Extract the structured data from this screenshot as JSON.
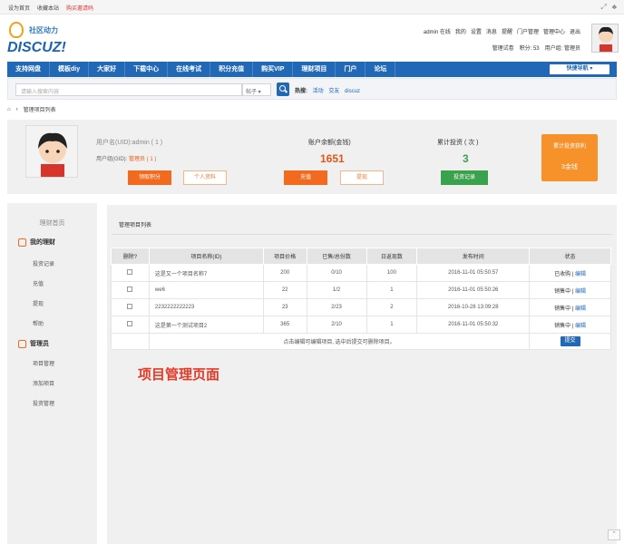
{
  "topbar": {
    "links": [
      "设为首页",
      "收藏本站"
    ],
    "notice": "购买邀请码",
    "icons": [
      "expand-icon",
      "paint-icon"
    ]
  },
  "brand": {
    "cn": "社区动力",
    "en": "DISCUZ!"
  },
  "header": {
    "row1": [
      "admin 在线",
      "我的",
      "设置",
      "消息",
      "提醒",
      "门户管理",
      "管理中心",
      "退出"
    ],
    "row2": [
      "管理试卷",
      "积分: 53",
      "用户组: 管理员"
    ]
  },
  "nav": {
    "items": [
      "支持网盘",
      "模板diy",
      "大家好",
      "下载中心",
      "在线考试",
      "积分充值",
      "购买VIP",
      "理财项目",
      "门户",
      "论坛"
    ],
    "quick": "快捷导航"
  },
  "search": {
    "placeholder": "请输入搜索内容",
    "scope": "帖子",
    "hot_label": "热搜:",
    "hot": [
      "活动",
      "交友",
      "discuz"
    ]
  },
  "breadcrumb": {
    "current": "管理项目列表"
  },
  "profile": {
    "name_line": "用户名(UID):admin ( 1 )",
    "group_label": "用户组(GID):",
    "group_value": "管理员 ( 1 )",
    "btn_points": "领取积分",
    "btn_info": "个人资料",
    "balance_label": "账户余额(金钱)",
    "balance_value": "1651",
    "btn_recharge": "充值",
    "btn_withdraw": "提现",
    "invest_label": "累计投资 ( 次 )",
    "invest_value": "3",
    "btn_records": "投资记录",
    "earn_label": "累计投资获利",
    "earn_value": "3金钱"
  },
  "sidebar": {
    "title": "理财首页",
    "group1": "我的理财",
    "group1_items": [
      "投资记录",
      "充值",
      "提现",
      "帮助"
    ],
    "group2": "管理员",
    "group2_items": [
      "项目管理",
      "添加项目",
      "投资管理"
    ]
  },
  "panel": {
    "title": "管理项目列表",
    "columns": [
      "删除?",
      "项目名称(ID)",
      "项目价格",
      "已售/总份数",
      "日返现数",
      "发布时间",
      "状态"
    ],
    "rows": [
      {
        "name": "这是又一个项目名称7",
        "price": "200",
        "sold": "0/10",
        "daily": "100",
        "time": "2016-11-01 05:50:57",
        "status": "已收购",
        "edit": "编辑"
      },
      {
        "name": "we6",
        "price": "22",
        "sold": "1/2",
        "daily": "1",
        "time": "2016-11-01 05:50:26",
        "status": "销售中",
        "edit": "编辑"
      },
      {
        "name": "2232222222223",
        "price": "23",
        "sold": "2/23",
        "daily": "2",
        "time": "2016-10-28 13:09:28",
        "status": "销售中",
        "edit": "编辑"
      },
      {
        "name": "这是第一个测试项目2",
        "price": "365",
        "sold": "2/10",
        "daily": "1",
        "time": "2016-11-01 05:50:32",
        "status": "销售中",
        "edit": "编辑"
      }
    ],
    "footer_note": "点击编辑可编辑项目, 选中后提交可删除项目。",
    "submit": "提交"
  },
  "caption": "项目管理页面",
  "colors": {
    "nav": "#2168b6",
    "orange": "#f26a1e",
    "green": "#3aa14c",
    "caption": "#e53a27"
  }
}
